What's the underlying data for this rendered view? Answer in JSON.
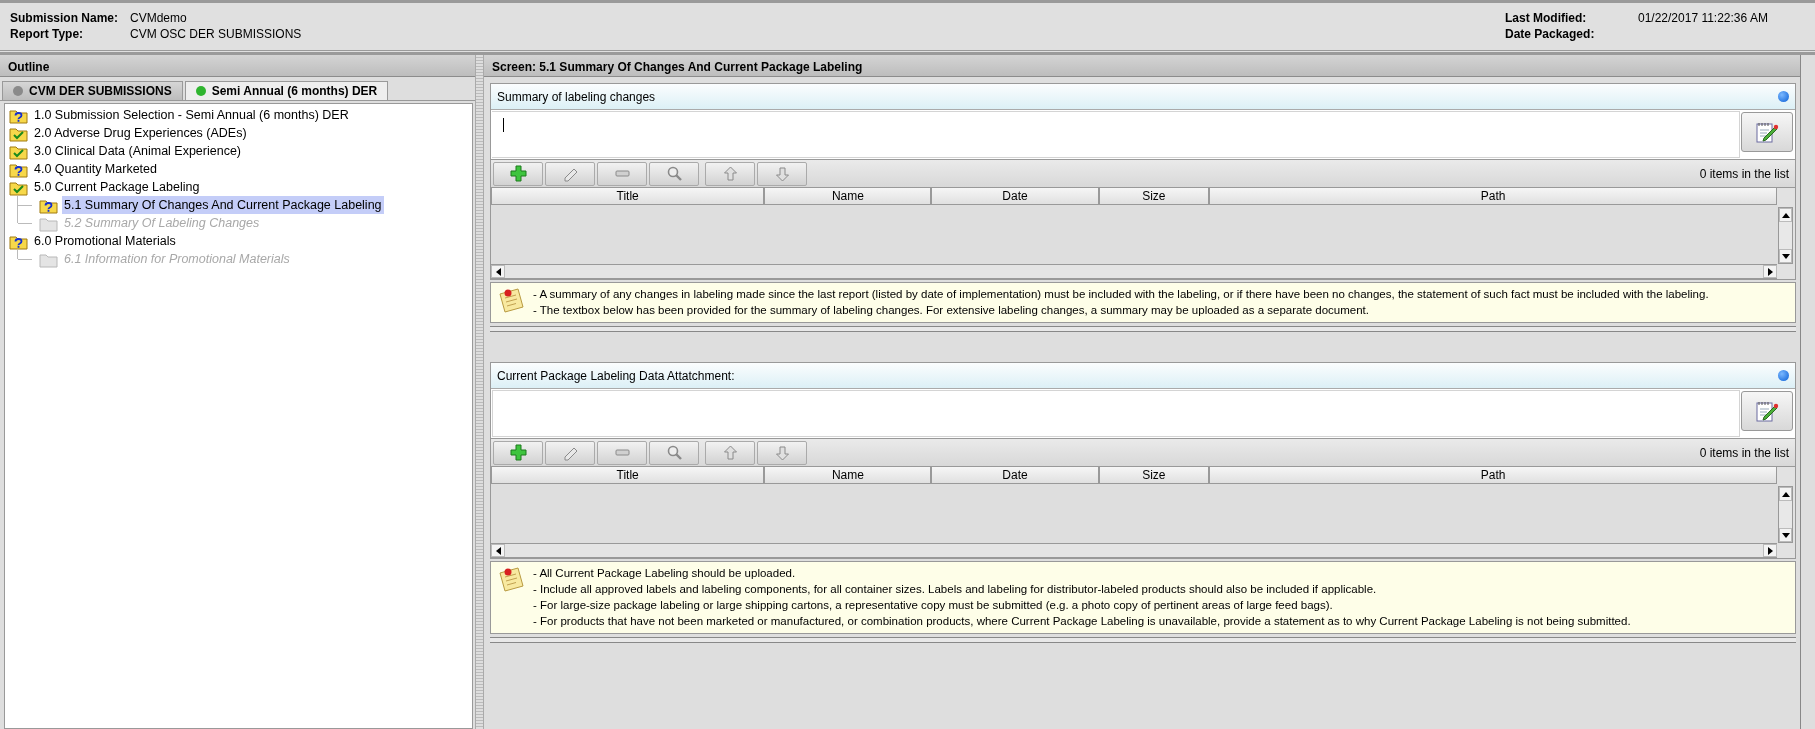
{
  "header": {
    "fields_left": [
      {
        "label": "Submission Name:",
        "value": "CVMdemo"
      },
      {
        "label": "Report Type:",
        "value": "CVM OSC DER SUBMISSIONS"
      }
    ],
    "fields_right": [
      {
        "label": "Last Modified:",
        "value": "01/22/2017 11:22:36 AM"
      },
      {
        "label": "Date Packaged:"
      }
    ]
  },
  "outline": {
    "title": "Outline",
    "tabs": [
      {
        "label": "CVM DER SUBMISSIONS",
        "selected": false,
        "color": "#8a8a8a"
      },
      {
        "label": "Semi Annual (6 months) DER",
        "selected": true,
        "color": "#2fb52f"
      }
    ],
    "tree": [
      {
        "label": "1.0 Submission Selection - Semi Annual (6 months) DER",
        "kind": "question",
        "selected": false,
        "disabled": false
      },
      {
        "label": "2.0 Adverse Drug Experiences (ADEs)",
        "kind": "check",
        "selected": false,
        "disabled": false
      },
      {
        "label": "3.0 Clinical Data (Animal Experience)",
        "kind": "check",
        "selected": false,
        "disabled": false
      },
      {
        "label": "4.0 Quantity Marketed",
        "kind": "question",
        "selected": false,
        "disabled": false
      },
      {
        "label": "5.0 Current Package Labeling",
        "kind": "check",
        "selected": false,
        "disabled": false,
        "children": [
          {
            "label": "5.1 Summary Of Changes And Current Package Labeling",
            "kind": "question",
            "selected": true,
            "disabled": false
          },
          {
            "label": "5.2 Summary Of Labeling Changes",
            "kind": "empty",
            "selected": false,
            "disabled": true
          }
        ]
      },
      {
        "label": "6.0 Promotional Materials",
        "kind": "question",
        "selected": false,
        "disabled": false,
        "children": [
          {
            "label": "6.1 Information for Promotional Materials",
            "kind": "empty",
            "selected": false,
            "disabled": true
          }
        ]
      }
    ]
  },
  "screen": {
    "title": "Screen: 5.1 Summary Of Changes And Current Package Labeling",
    "panels": [
      {
        "title": "Summary of labeling changes",
        "focused": true,
        "item_count": "0 items in the list",
        "columns": [
          "Title",
          "Name",
          "Date",
          "Size",
          "Path"
        ],
        "notes": [
          "- A summary of any changes in labeling made since the last report (listed by date of implementation) must be included with the labeling, or if there have been no changes, the statement of such fact must be included with the labeling.",
          "- The textbox below has been provided for the summary of labeling changes. For extensive labeling changes, a summary may be uploaded as a separate document."
        ]
      },
      {
        "title": "Current Package Labeling Data Attatchment:",
        "focused": false,
        "item_count": "0 items in the list",
        "columns": [
          "Title",
          "Name",
          "Date",
          "Size",
          "Path"
        ],
        "notes": [
          "- All Current Package Labeling should be uploaded.",
          "- Include all approved labels and labeling components, for all container sizes. Labels and labeling for distributor-labeled products should also be included if applicable.",
          "-  For large-size package labeling or large shipping cartons, a representative copy must be submitted (e.g. a photo copy of pertinent areas of large feed bags).",
          "- For products that have not been marketed or manufactured, or combination products, where Current Package Labeling is unavailable, provide a statement as to why Current Package Labeling is not being submitted."
        ]
      }
    ]
  }
}
